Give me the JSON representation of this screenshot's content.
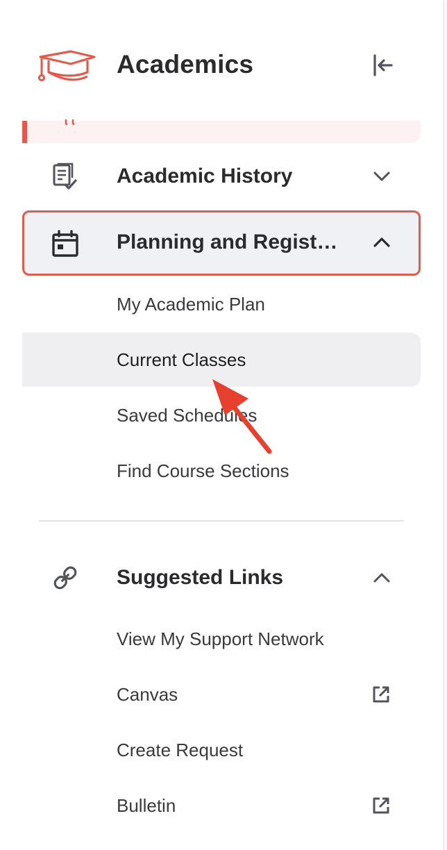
{
  "header": {
    "title": "Academics",
    "logo_icon": "graduation-cap-icon",
    "collapse_icon": "collapse-left-icon"
  },
  "colors": {
    "accent": "#e35a4c",
    "text": "#2b2b2e",
    "icon": "#52535c",
    "active_bg": "#efeff1",
    "selected_bg": "#f0f1f4"
  },
  "nav": {
    "academic_history": {
      "label": "Academic History",
      "icon": "document-check-icon",
      "expanded": false
    },
    "planning": {
      "label": "Planning and Registr…",
      "icon": "calendar-icon",
      "expanded": true,
      "items": [
        {
          "label": "My Academic Plan"
        },
        {
          "label": "Current Classes",
          "active": true
        },
        {
          "label": "Saved Schedules"
        },
        {
          "label": "Find Course Sections"
        }
      ]
    },
    "suggested_links": {
      "label": "Suggested Links",
      "icon": "link-icon",
      "expanded": true,
      "items": [
        {
          "label": "View My Support Network",
          "external": false
        },
        {
          "label": "Canvas",
          "external": true
        },
        {
          "label": "Create Request",
          "external": false
        },
        {
          "label": "Bulletin",
          "external": true
        }
      ]
    }
  }
}
